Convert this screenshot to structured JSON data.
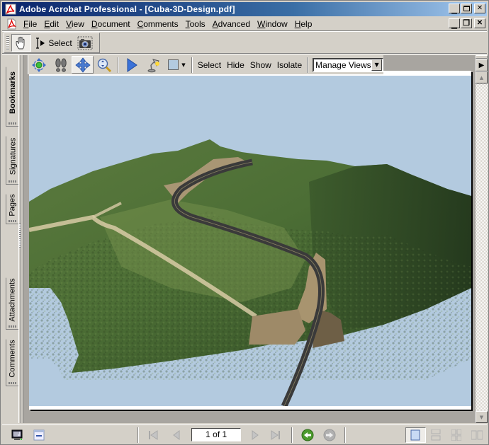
{
  "window": {
    "title": "Adobe Acrobat Professional - [Cuba-3D-Design.pdf]",
    "controls": {
      "minimize": "_",
      "maximize": "□",
      "close": "×",
      "restore": "❐"
    }
  },
  "menu": {
    "items": [
      {
        "label": "File",
        "accel": "F"
      },
      {
        "label": "Edit",
        "accel": "E"
      },
      {
        "label": "View",
        "accel": "V"
      },
      {
        "label": "Document",
        "accel": "D"
      },
      {
        "label": "Comments",
        "accel": "C"
      },
      {
        "label": "Tools",
        "accel": "T"
      },
      {
        "label": "Advanced",
        "accel": "A"
      },
      {
        "label": "Window",
        "accel": "W"
      },
      {
        "label": "Help",
        "accel": "H"
      }
    ]
  },
  "basic_toolbar": {
    "hand_tool": "hand-tool",
    "select_label": "Select",
    "snapshot_tool": "snapshot-tool"
  },
  "toolbar_3d": {
    "tools": [
      "rotate",
      "walk",
      "pan",
      "zoom"
    ],
    "active_tool": "pan",
    "play_animation": "play",
    "lighting": "lighting",
    "background_color": "#b3cadf",
    "actions": [
      "Select",
      "Hide",
      "Show",
      "Isolate"
    ],
    "views_dropdown": "Manage Views..."
  },
  "nav_tabs": [
    {
      "label": "Bookmarks",
      "active": true
    },
    {
      "label": "Signatures",
      "active": false
    },
    {
      "label": "Pages",
      "active": false
    },
    {
      "label": "Attachments",
      "active": false
    },
    {
      "label": "Comments",
      "active": false
    }
  ],
  "scene": {
    "description": "3D terrain model with road design",
    "sky_color": "#b3cadf",
    "terrain_color": "#4a6b33",
    "road_color": "#3c3c3c",
    "embankment_color": "#a89674"
  },
  "status": {
    "page_display": "1 of 1",
    "current_page": 1,
    "total_pages": 1,
    "layout": "single-page"
  }
}
